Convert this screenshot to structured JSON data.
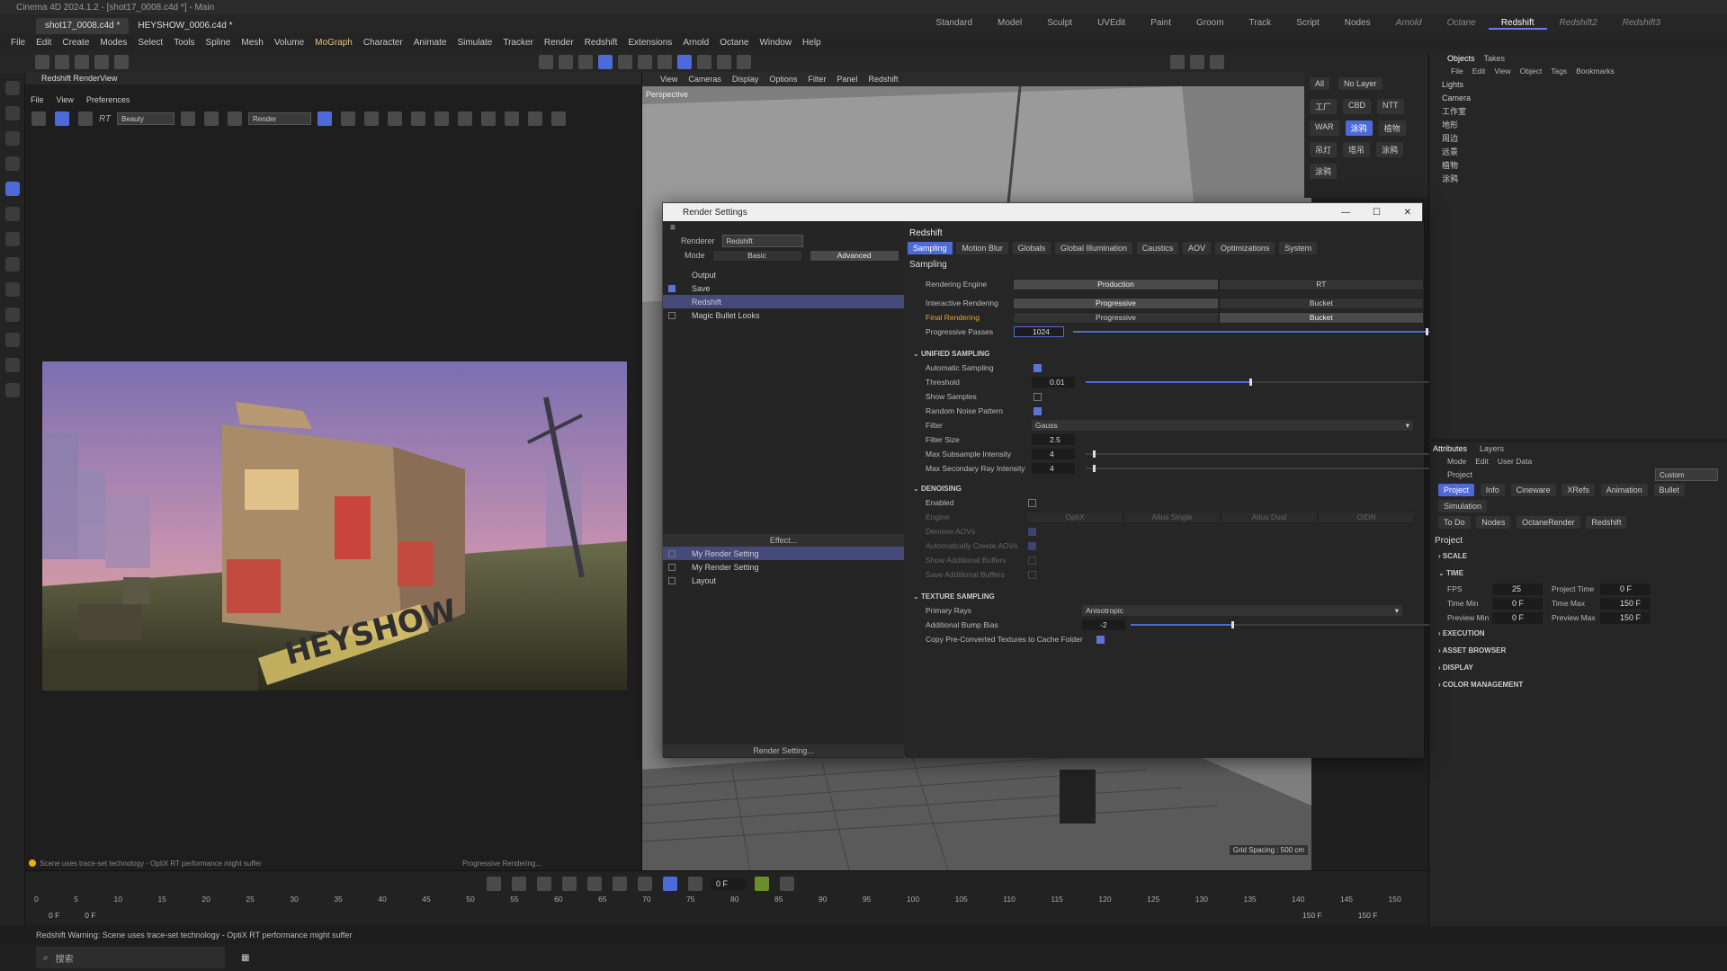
{
  "window": {
    "title": "Cinema 4D 2024.1.2 - [shot17_0008.c4d *] - Main"
  },
  "doc_tabs": [
    {
      "label": "shot17_0008.c4d *"
    },
    {
      "label": "HEYSHOW_0006.c4d *"
    }
  ],
  "layouts": [
    "Standard",
    "Model",
    "Sculpt",
    "UVEdit",
    "Paint",
    "Groom",
    "Track",
    "Script",
    "Nodes",
    "Arnold",
    "Octane",
    "Redshift",
    "Redshift2",
    "Redshift3"
  ],
  "layout_active": "Redshift",
  "main_menu": [
    "File",
    "Edit",
    "Create",
    "Modes",
    "Select",
    "Tools",
    "Spline",
    "Mesh",
    "Volume",
    "MoGraph",
    "Character",
    "Animate",
    "Simulate",
    "Tracker",
    "Render",
    "Redshift",
    "Extensions",
    "Arnold",
    "Octane",
    "Window",
    "Help"
  ],
  "renderview": {
    "title": "Redshift RenderView",
    "menu": [
      "File",
      "View",
      "Preferences"
    ],
    "aov_select": "Beauty",
    "render_select": "Render",
    "status_left": "Scene uses trace-set technology - OptiX RT performance might suffer",
    "status_right": "Progressive Rendering...",
    "image": {
      "sign_text": "HEYSHOW",
      "sky_colors": [
        "#7a6fb0",
        "#c28fb0",
        "#e9b08c"
      ]
    }
  },
  "viewport": {
    "menu": [
      "View",
      "Cameras",
      "Display",
      "Options",
      "Filter",
      "Panel",
      "Redshift"
    ],
    "camera_label": "Perspective",
    "grid_spacing": "Grid Spacing : 500 cm"
  },
  "objects_panel": {
    "tabs": [
      "Objects",
      "Takes"
    ],
    "menu": [
      "File",
      "Edit",
      "View",
      "Object",
      "Tags",
      "Bookmarks"
    ],
    "items": [
      "Lights",
      "Camera",
      "工作室",
      "地形",
      "周边",
      "远景",
      "植物",
      "涂鸦"
    ]
  },
  "layer_panel": {
    "buttons": [
      "All",
      "No Layer"
    ],
    "tags": [
      "工厂",
      "CBD",
      "NTT",
      "WAR",
      "涂鸦",
      "植物",
      "吊灯",
      "塔吊",
      "涂鸦",
      "涂鸦"
    ]
  },
  "attributes_panel": {
    "tabs": [
      "Attributes",
      "Layers"
    ],
    "menu": [
      "Mode",
      "Edit",
      "User Data"
    ],
    "header": "Project",
    "preset": "Custom",
    "buttons_row1": [
      "Project",
      "Info",
      "Cineware",
      "XRefs",
      "Animation",
      "Bullet",
      "Simulation"
    ],
    "buttons_row2": [
      "To Do",
      "Nodes",
      "OctaneRender",
      "Redshift"
    ],
    "section_title": "Project",
    "sections": [
      "SCALE",
      "TIME",
      "EXECUTION",
      "ASSET BROWSER",
      "DISPLAY",
      "COLOR MANAGEMENT"
    ],
    "time": {
      "fps_label": "FPS",
      "fps": "25",
      "project_time_label": "Project Time",
      "project_time": "0 F",
      "time_min_label": "Time Min",
      "time_min": "0 F",
      "time_max_label": "Time Max",
      "time_max": "150 F",
      "preview_min_label": "Preview Min",
      "preview_min": "0 F",
      "preview_max_label": "Preview Max",
      "preview_max": "150 F"
    }
  },
  "render_settings": {
    "title": "Render Settings",
    "renderer_label": "Renderer",
    "renderer": "Redshift",
    "mode_label": "Mode",
    "mode_basic": "Basic",
    "mode_advanced": "Advanced",
    "tree": [
      "Output",
      "Save",
      "Redshift",
      "Magic Bullet Looks"
    ],
    "effect_button": "Effect...",
    "settings_list": [
      "My Render Setting",
      "My Render Setting",
      "Layout"
    ],
    "render_setting_button": "Render Setting...",
    "panel_title": "Redshift",
    "tabs": [
      "Sampling",
      "Motion Blur",
      "Globals",
      "Global Illumination",
      "Caustics",
      "AOV",
      "Optimizations",
      "System"
    ],
    "section": "Sampling",
    "rendering_engine_label": "Rendering Engine",
    "engine_production": "Production",
    "engine_rt": "RT",
    "interactive_label": "Interactive Rendering",
    "final_label": "Final Rendering",
    "progressive": "Progressive",
    "bucket": "Bucket",
    "passes_label": "Progressive Passes",
    "passes_value": "1024",
    "unified": {
      "title": "UNIFIED SAMPLING",
      "auto_label": "Automatic Sampling",
      "threshold_label": "Threshold",
      "threshold": "0.01",
      "show_samples_label": "Show Samples",
      "random_noise_label": "Random Noise Pattern",
      "filter_label": "Filter",
      "filter": "Gauss",
      "filter_size_label": "Filter Size",
      "filter_size": "2.5",
      "max_sub_label": "Max Subsample Intensity",
      "max_sub": "4",
      "max_sec_label": "Max Secondary Ray Intensity",
      "max_sec": "4"
    },
    "denoising": {
      "title": "DENOISING",
      "enabled_label": "Enabled",
      "engine_label": "Engine",
      "engines": [
        "OptiX",
        "Altus Single",
        "Altus Dual",
        "OIDN"
      ],
      "denoise_aovs_label": "Denoise AOVs",
      "auto_aovs_label": "Automatically Create AOVs",
      "show_buffers_label": "Show Additional Buffers",
      "save_buffers_label": "Save Additional Buffers"
    },
    "texture": {
      "title": "TEXTURE SAMPLING",
      "primary_label": "Primary Rays",
      "primary": "Anisotropic",
      "bump_label": "Additional Bump Bias",
      "bump": "-2",
      "copy_label": "Copy Pre-Converted Textures to Cache Folder"
    }
  },
  "timeline": {
    "frame": "0 F",
    "ticks": [
      "0",
      "5",
      "10",
      "15",
      "20",
      "25",
      "30",
      "35",
      "40",
      "45",
      "50",
      "55",
      "60",
      "65",
      "70",
      "75",
      "80",
      "85",
      "90",
      "95",
      "100",
      "105",
      "110",
      "115",
      "120",
      "125",
      "130",
      "135",
      "140",
      "145",
      "150"
    ],
    "start": "0 F",
    "start2": "0 F",
    "end": "150 F",
    "end2": "150 F"
  },
  "status": {
    "message": "Redshift Warning: Scene uses trace-set technology - OptiX RT performance might suffer"
  },
  "taskbar": {
    "search": "搜索"
  }
}
